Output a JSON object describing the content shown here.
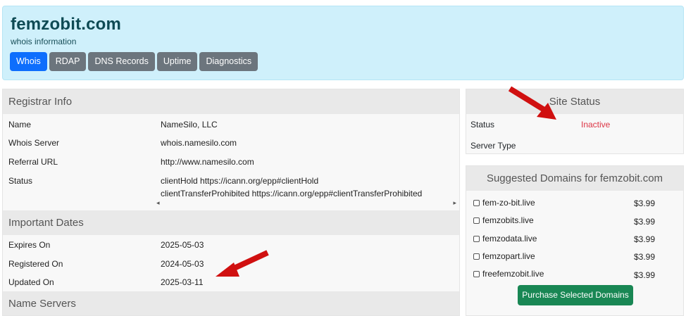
{
  "header": {
    "domain": "femzobit.com",
    "subtitle": "whois information",
    "tabs": [
      "Whois",
      "RDAP",
      "DNS Records",
      "Uptime",
      "Diagnostics"
    ],
    "active_tab": "Whois"
  },
  "registrar": {
    "title": "Registrar Info",
    "rows": [
      {
        "label": "Name",
        "value": "NameSilo, LLC"
      },
      {
        "label": "Whois Server",
        "value": "whois.namesilo.com"
      },
      {
        "label": "Referral URL",
        "value": "http://www.namesilo.com"
      },
      {
        "label": "Status",
        "value": "clientHold https://icann.org/epp#clientHold",
        "value2": "clientTransferProhibited https://icann.org/epp#clientTransferProhibited"
      }
    ],
    "scroll_left": "◂",
    "scroll_right": "▸"
  },
  "dates": {
    "title": "Important Dates",
    "rows": [
      {
        "label": "Expires On",
        "value": "2025-05-03"
      },
      {
        "label": "Registered On",
        "value": "2024-05-03"
      },
      {
        "label": "Updated On",
        "value": "2025-03-11"
      }
    ]
  },
  "nameservers": {
    "title": "Name Servers"
  },
  "site_status": {
    "title": "Site Status",
    "rows": [
      {
        "label": "Status",
        "value": "Inactive"
      },
      {
        "label": "Server Type",
        "value": ""
      }
    ]
  },
  "suggested": {
    "title": "Suggested Domains for femzobit.com",
    "items": [
      {
        "name": "fem-zo-bit.live",
        "price": "$3.99"
      },
      {
        "name": "femzobits.live",
        "price": "$3.99"
      },
      {
        "name": "femzodata.live",
        "price": "$3.99"
      },
      {
        "name": "femzopart.live",
        "price": "$3.99"
      },
      {
        "name": "freefemzobit.live",
        "price": "$3.99"
      }
    ],
    "button": "Purchase Selected Domains"
  },
  "colors": {
    "header_bg": "#cff0fb",
    "active_tab": "#0d6efd",
    "tab": "#6c757d",
    "inactive": "#dc3545",
    "purchase_button": "#198754",
    "annotation_arrow": "#d01010"
  }
}
